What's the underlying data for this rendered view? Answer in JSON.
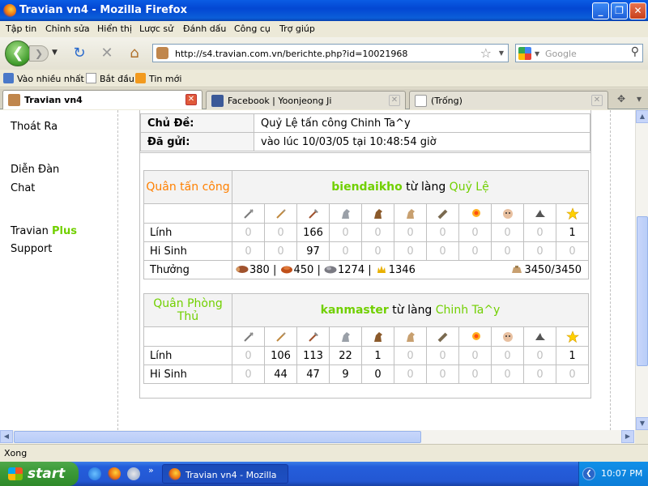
{
  "window": {
    "title": "Travian vn4 - Mozilla Firefox"
  },
  "menu": [
    "Tập tin",
    "Chỉnh sửa",
    "Hiển thị",
    "Lược sử",
    "Đánh dấu",
    "Công cụ",
    "Trợ giúp"
  ],
  "nav": {
    "url": "http://s4.travian.com.vn/berichte.php?id=10021968",
    "search_placeholder": "Google"
  },
  "bookmarks": [
    "Vào nhiều nhất",
    "Bắt đầu",
    "Tin mới"
  ],
  "tabs": [
    {
      "label": "Travian vn4",
      "active": true
    },
    {
      "label": "Facebook | Yoonjeong Ji",
      "active": false
    },
    {
      "label": "(Trống)",
      "active": false
    }
  ],
  "sidebar": {
    "logout": "Thoát Ra",
    "forum": "Diễn Đàn",
    "chat": "Chat",
    "travian": "Travian",
    "plus": "Plus",
    "support": "Support"
  },
  "report": {
    "subject_label": "Chủ Đề:",
    "subject": "Quỷ Lệ tấn công Chinh Ta^y",
    "sent_label": "Đã gửi:",
    "sent": "vào lúc 10/03/05 tại 10:48:54 giờ"
  },
  "attacker": {
    "role": "Quân tấn công",
    "player": "biendaikho",
    "from": "từ làng",
    "village": "Quỷ Lệ",
    "troops_label": "Lính",
    "troops": [
      "0",
      "0",
      "166",
      "0",
      "0",
      "0",
      "0",
      "0",
      "0",
      "0",
      "1"
    ],
    "casualties_label": "Hi Sinh",
    "casualties": [
      "0",
      "0",
      "97",
      "0",
      "0",
      "0",
      "0",
      "0",
      "0",
      "0",
      "0"
    ],
    "bounty_label": "Thưởng",
    "bounty": {
      "wood": "380",
      "clay": "450",
      "iron": "1274",
      "crop": "1346",
      "sep": "|",
      "carry": "3450/3450"
    }
  },
  "defender": {
    "role": "Quân Phòng Thủ",
    "player": "kanmaster",
    "from": "từ làng",
    "village": "Chinh Ta^y",
    "troops_label": "Lính",
    "troops": [
      "0",
      "106",
      "113",
      "22",
      "1",
      "0",
      "0",
      "0",
      "0",
      "0",
      "1"
    ],
    "casualties_label": "Hi Sinh",
    "casualties": [
      "0",
      "44",
      "47",
      "9",
      "0",
      "0",
      "0",
      "0",
      "0",
      "0",
      "0"
    ]
  },
  "unit_icons": [
    "club-icon",
    "spear-icon",
    "axe-icon",
    "scout-horse-icon",
    "paladin-icon",
    "teuton-knight-icon",
    "ram-icon",
    "catapult-icon",
    "chief-icon",
    "settler-icon",
    "hero-icon"
  ],
  "status": {
    "text": "Xong"
  },
  "taskbar": {
    "start": "start",
    "task": "Travian vn4 - Mozilla ...",
    "clock": "10:07 PM"
  },
  "colors": {
    "attacker": "#ff8000",
    "defender": "#71d000",
    "zero": "#c0c0c0"
  }
}
